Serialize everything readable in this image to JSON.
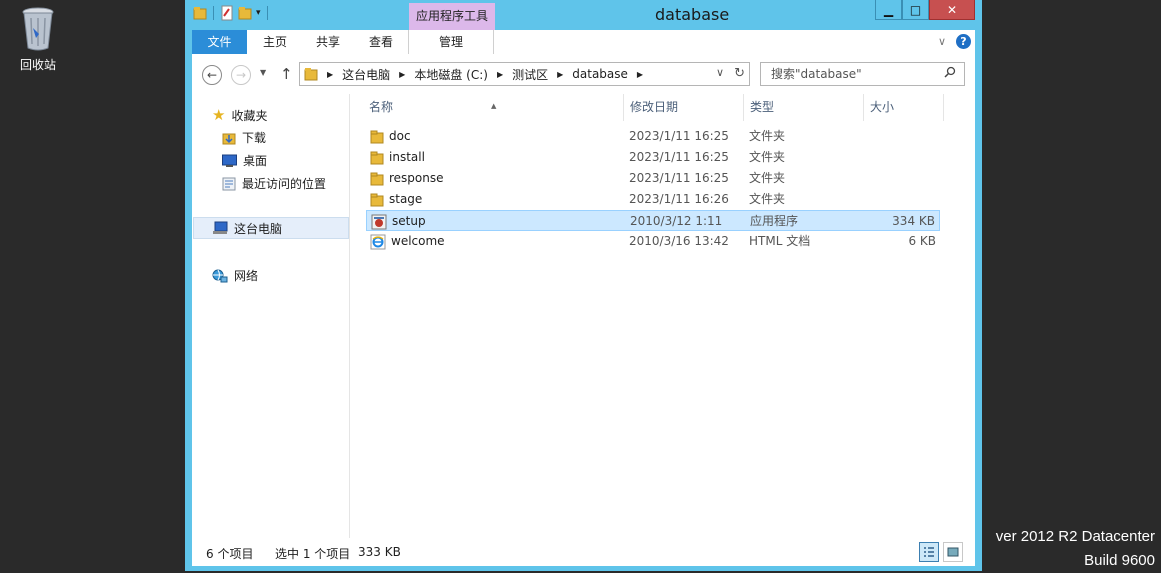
{
  "desktop": {
    "recycle_bin_label": "回收站",
    "watermark_line1": "ver 2012 R2 Datacenter",
    "watermark_line2": "Build 9600"
  },
  "window": {
    "title": "database",
    "context_tab_label": "应用程序工具",
    "buttons": {
      "minimize": "▁",
      "maximize": "□",
      "close": "✕"
    }
  },
  "ribbon": {
    "tabs": {
      "file": "文件",
      "home": "主页",
      "share": "共享",
      "view": "查看",
      "manage": "管理"
    },
    "expand_icon": "chevron-down-icon",
    "help_label": "?"
  },
  "address": {
    "crumbs": [
      "这台电脑",
      "本地磁盘 (C:)",
      "测试区",
      "database"
    ],
    "search_placeholder": "搜索\"database\""
  },
  "navpane": {
    "favorites": "收藏夹",
    "downloads": "下载",
    "desktop": "桌面",
    "recent": "最近访问的位置",
    "this_pc": "这台电脑",
    "network": "网络"
  },
  "columns": {
    "name": "名称",
    "date": "修改日期",
    "type": "类型",
    "size": "大小"
  },
  "files": [
    {
      "name": "doc",
      "date": "2023/1/11 16:25",
      "type": "文件夹",
      "size": "",
      "icon": "folder-icon"
    },
    {
      "name": "install",
      "date": "2023/1/11 16:25",
      "type": "文件夹",
      "size": "",
      "icon": "folder-icon"
    },
    {
      "name": "response",
      "date": "2023/1/11 16:25",
      "type": "文件夹",
      "size": "",
      "icon": "folder-icon"
    },
    {
      "name": "stage",
      "date": "2023/1/11 16:26",
      "type": "文件夹",
      "size": "",
      "icon": "folder-icon"
    },
    {
      "name": "setup",
      "date": "2010/3/12 1:11",
      "type": "应用程序",
      "size": "334 KB",
      "icon": "setup-exe-icon",
      "selected": true
    },
    {
      "name": "welcome",
      "date": "2010/3/16 13:42",
      "type": "HTML 文档",
      "size": "6 KB",
      "icon": "ie-html-icon"
    }
  ],
  "status": {
    "item_count": "6 个项目",
    "selected": "选中 1 个项目",
    "selected_size": "333 KB"
  },
  "colors": {
    "title_bar": "#5fc4ea",
    "file_tab": "#2b8dd8",
    "context_tab": "#dcb8ea",
    "close_button": "#c75050",
    "selection": "#cce8ff"
  }
}
